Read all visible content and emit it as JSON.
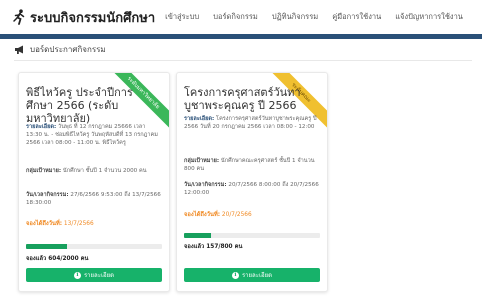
{
  "brand": {
    "title": "ระบบกิจกรรมนักศึกษา"
  },
  "nav": {
    "items": [
      {
        "label": "เข้าสู่ระบบ"
      },
      {
        "label": "บอร์ดกิจกรรม"
      },
      {
        "label": "ปฏิทินกิจกรรม"
      },
      {
        "label": "คู่มือการใช้งาน"
      },
      {
        "label": "แจ้งปัญหาการใช้งาน"
      }
    ]
  },
  "section": {
    "title": "บอร์ดประกาศกิจกรรม"
  },
  "colors": {
    "accent_bar": "#2a5078",
    "button": "#17b26a",
    "progress": "#17a05d",
    "close_date": "#f08a24"
  },
  "cards": [
    {
      "ribbon": "ระดับมหาวิทยาลัย",
      "title": "พิธีไหว้ครู ประจำปีการศึกษา 2566 (ระดับมหาวิทยาลัย)",
      "detail_label": "รายละเอียด:",
      "detail_text": " วันพุธ ที่ 12 กรกฎาคม 25666 เวลา 13:30 น. - ช่อมพิธีไหว้ครู วันพฤหัสบดีที่ 13 กรกฎาคม 2566 เวลา 08:00 - 11:00 น. พิธีไหว้ครู",
      "target_label": "กลุ่มเป้าหมาย:",
      "target_text": " นักศึกษา ชั้นปี 1 จำนวน 2000 คน",
      "datetime_label": "วัน/เวลากิจกรรม:",
      "datetime_text": " 27/6/2566 9:53:00 ถึง 13/7/2566 18:30:00",
      "close_label": "จองได้ถึงวันที่:",
      "close_text": " 13/7/2566",
      "reserved": "จองแล้ว 604/2000 คน",
      "progress": 0.302,
      "button": "รายละเอียด"
    },
    {
      "ribbon": "ระดับคณะ",
      "title": "โครงการครุศาสตร์วันทาบูชาพระคุณครู ปี 2566",
      "detail_label": "รายละเอียด:",
      "detail_text": " โครงการครุศาสตร์วันทาบูชาพระคุณครู ปี 2566 วันที่ 20 กรกฎาคม 2566 เวลา 08:00 - 12:00",
      "target_label": "กลุ่มเป้าหมาย:",
      "target_text": " นักศึกษาคณะครุศาสตร์ ชั้นปี 1 จำนวน 800 คน",
      "datetime_label": "วัน/เวลากิจกรรม:",
      "datetime_text": " 20/7/2566 8:00:00 ถึง 20/7/2566 12:00:00",
      "close_label": "จองได้ถึงวันที่:",
      "close_text": " 20/7/2566",
      "reserved": "จองแล้ว 157/800 คน",
      "progress": 0.196,
      "button": "รายละเอียด"
    }
  ]
}
